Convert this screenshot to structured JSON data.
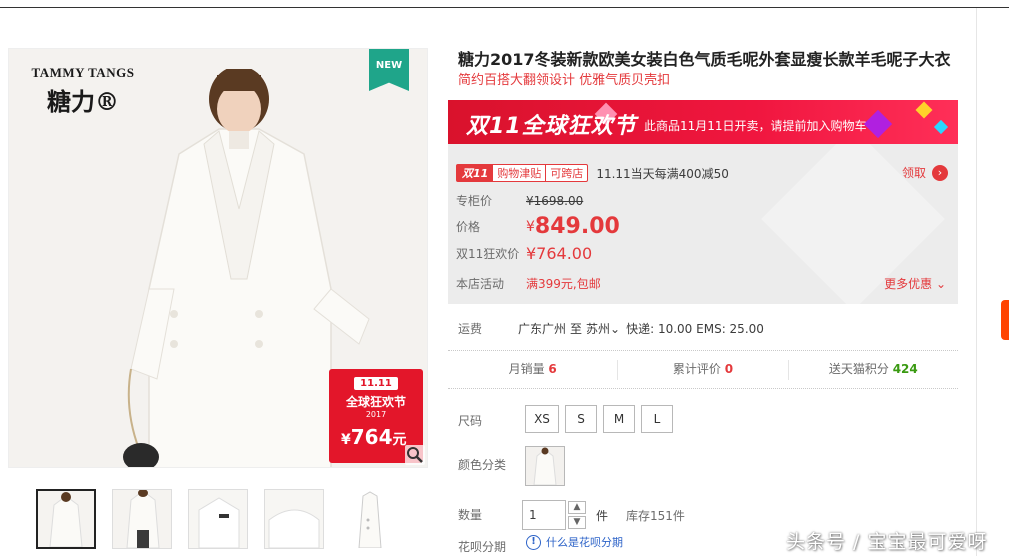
{
  "product": {
    "title": "糖力2017冬装新款欧美女装白色气质毛呢外套显瘦长款羊毛呢子大衣",
    "subtitle": "简约百搭大翻领设计 优雅气质贝壳扣"
  },
  "image": {
    "brand_en": "TAMMY TANGS",
    "brand_cn": "糖力®",
    "new_badge": "NEW",
    "promo_11": "11.11",
    "promo_name": "全球狂欢节",
    "promo_year": "2017",
    "promo_currency": "¥",
    "promo_price": "764",
    "promo_suffix": "元"
  },
  "banner": {
    "logo": "双11全球狂欢节",
    "text": "此商品11月11日开卖，请提前加入购物车"
  },
  "pricing": {
    "coupon_badge": "双11",
    "coupon_name": "购物津贴",
    "coupon_tag": "可跨店",
    "coupon_text": "11.11当天每满400减50",
    "get_label": "领取",
    "counter_label": "专柜价",
    "counter_price": "¥1698.00",
    "price_label": "价格",
    "currency": "¥",
    "price": "849.00",
    "festival_label": "双11狂欢价",
    "festival_price": "¥764.00",
    "activity_label": "本店活动",
    "activity_value": "满399元,包邮",
    "more_label": "更多优惠"
  },
  "shipping": {
    "label": "运费",
    "from": "广东广州",
    "to_word": "至",
    "to": "苏州",
    "rates": "快递: 10.00 EMS: 25.00"
  },
  "stats": {
    "monthly_label": "月销量",
    "monthly_value": "6",
    "reviews_label": "累计评价",
    "reviews_value": "0",
    "points_label": "送天猫积分",
    "points_value": "424"
  },
  "options": {
    "size_label": "尺码",
    "sizes": [
      "XS",
      "S",
      "M",
      "L"
    ],
    "color_label": "颜色分类",
    "qty_label": "数量",
    "qty_value": "1",
    "qty_unit": "件",
    "stock": "库存151件",
    "huabei_label": "花呗分期",
    "huabei_help": "什么是花呗分期"
  },
  "watermark": "头条号 / 宝宝最可爱呀",
  "colors": {
    "accent_red": "#e4393c",
    "banner_red": "#f0163f",
    "new_green": "#1fa58a",
    "points_green": "#3a9a12",
    "link_blue": "#2d63c8"
  }
}
